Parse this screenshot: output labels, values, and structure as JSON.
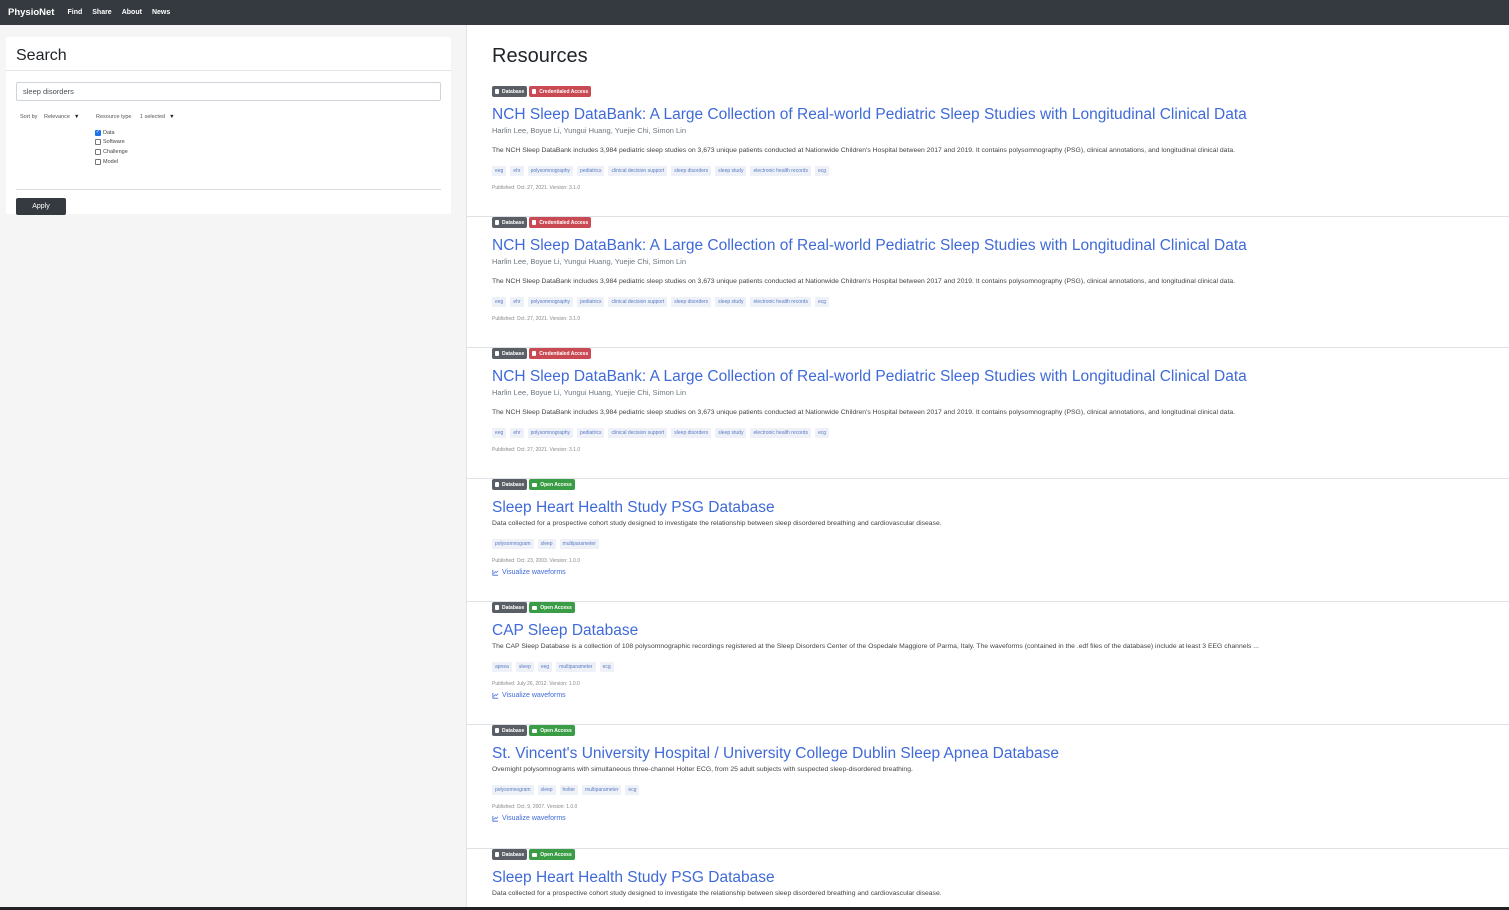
{
  "nav": {
    "brand": "PhysioNet",
    "links": [
      "Find",
      "Share",
      "About",
      "News"
    ]
  },
  "sidebar": {
    "title": "Search",
    "search_value": "sleep disorders",
    "sort_label": "Sort by",
    "sort_value": "Relevance",
    "resource_type_label": "Resource type",
    "resource_type_value": "1 selected",
    "resource_types": [
      {
        "label": "Data",
        "checked": true
      },
      {
        "label": "Software",
        "checked": false
      },
      {
        "label": "Challenge",
        "checked": false
      },
      {
        "label": "Model",
        "checked": false
      }
    ],
    "apply_label": "Apply"
  },
  "main": {
    "title": "Resources",
    "results": [
      {
        "type_badge": "Database",
        "access_badge": "Credentialed Access",
        "title": "NCH Sleep DataBank: A Large Collection of Real-world Pediatric Sleep Studies with Longitudinal Clinical Data",
        "authors": "Harlin Lee, Boyue Li, Yungui Huang, Yuejie Chi, Simon Lin",
        "description": "The NCH Sleep DataBank includes 3,984 pediatric sleep studies on 3,673 unique patients conducted at Nationwide Children's Hospital between 2017 and 2019. It contains polysomnography (PSG), clinical annotations, and longitudinal clinical data.",
        "tags": [
          "eeg",
          "ehr",
          "polysomnography",
          "pediatrics",
          "clinical decision support",
          "sleep disorders",
          "sleep study",
          "electronic health records",
          "ecg"
        ],
        "published": "Published: Oct. 27, 2021. Version: 3.1.0"
      },
      {
        "type_badge": "Database",
        "access_badge": "Credentialed Access",
        "title": "NCH Sleep DataBank: A Large Collection of Real-world Pediatric Sleep Studies with Longitudinal Clinical Data",
        "authors": "Harlin Lee, Boyue Li, Yungui Huang, Yuejie Chi, Simon Lin",
        "description": "The NCH Sleep DataBank includes 3,984 pediatric sleep studies on 3,673 unique patients conducted at Nationwide Children's Hospital between 2017 and 2019. It contains polysomnography (PSG), clinical annotations, and longitudinal clinical data.",
        "tags": [
          "eeg",
          "ehr",
          "polysomnography",
          "pediatrics",
          "clinical decision support",
          "sleep disorders",
          "sleep study",
          "electronic health records",
          "ecg"
        ],
        "published": "Published: Oct. 27, 2021. Version: 3.1.0"
      },
      {
        "type_badge": "Database",
        "access_badge": "Credentialed Access",
        "title": "NCH Sleep DataBank: A Large Collection of Real-world Pediatric Sleep Studies with Longitudinal Clinical Data",
        "authors": "Harlin Lee, Boyue Li, Yungui Huang, Yuejie Chi, Simon Lin",
        "description": "The NCH Sleep DataBank includes 3,984 pediatric sleep studies on 3,673 unique patients conducted at Nationwide Children's Hospital between 2017 and 2019. It contains polysomnography (PSG), clinical annotations, and longitudinal clinical data.",
        "tags": [
          "eeg",
          "ehr",
          "polysomnography",
          "pediatrics",
          "clinical decision support",
          "sleep disorders",
          "sleep study",
          "electronic health records",
          "ecg"
        ],
        "published": "Published: Oct. 27, 2021. Version: 3.1.0"
      },
      {
        "type_badge": "Database",
        "access_badge": "Open Access",
        "title": "Sleep Heart Health Study PSG Database",
        "description": "Data collected for a prospective cohort study designed to investigate the relationship between sleep disordered breathing and cardiovascular disease.",
        "tags": [
          "polysomnogram",
          "sleep",
          "multiparameter"
        ],
        "published": "Published: Oct. 23, 2003. Version: 1.0.0",
        "visualize": "Visualize waveforms"
      },
      {
        "type_badge": "Database",
        "access_badge": "Open Access",
        "title": "CAP Sleep Database",
        "description": "The CAP Sleep Database is a collection of 108 polysomnographic recordings registered at the Sleep Disorders Center of the Ospedale Maggiore of Parma, Italy. The waveforms (contained in the .edf files of the database) include at least 3 EEG channels ...",
        "tags": [
          "apnea",
          "sleep",
          "eeg",
          "multiparameter",
          "ecg"
        ],
        "published": "Published: July 26, 2012. Version: 1.0.0",
        "visualize": "Visualize waveforms"
      },
      {
        "type_badge": "Database",
        "access_badge": "Open Access",
        "title": "St. Vincent's University Hospital / University College Dublin Sleep Apnea Database",
        "description": "Overnight polysomnograms with simultaneous three-channel Holter ECG, from 25 adult subjects with suspected sleep-disordered breathing.",
        "tags": [
          "polysomnogram",
          "sleep",
          "holter",
          "multiparameter",
          "ecg"
        ],
        "published": "Published: Oct. 9, 2007. Version: 1.0.0",
        "visualize": "Visualize waveforms"
      },
      {
        "type_badge": "Database",
        "access_badge": "Open Access",
        "title": "Sleep Heart Health Study PSG Database",
        "description": "Data collected for a prospective cohort study designed to investigate the relationship between sleep disordered breathing and cardiovascular disease."
      }
    ]
  }
}
